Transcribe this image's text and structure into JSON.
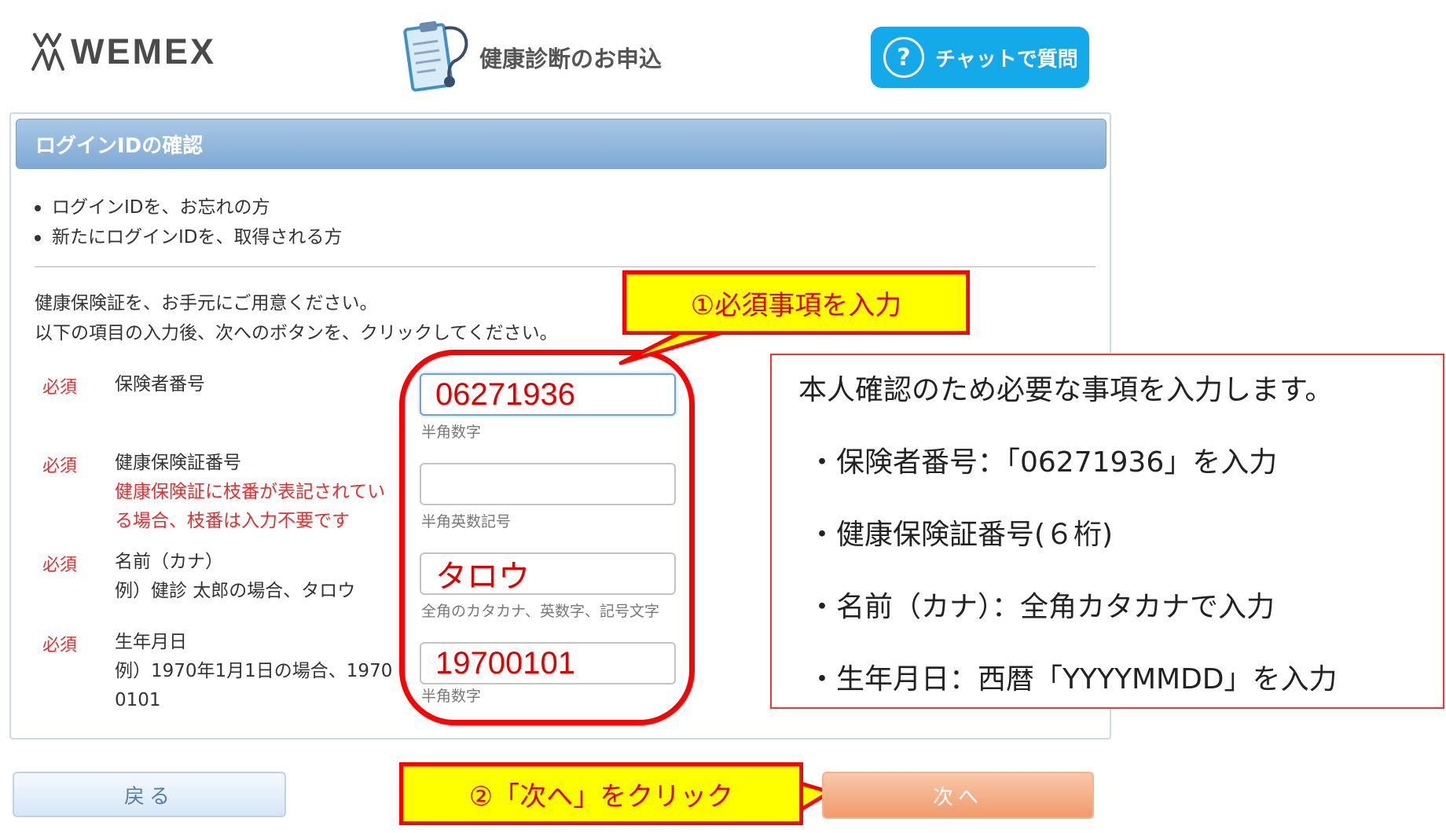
{
  "header": {
    "logo_text": "WEMEX",
    "title": "健康診断のお申込",
    "chat_icon_text": "?",
    "chat_label": "チャットで質問"
  },
  "panel": {
    "title": "ログインIDの確認",
    "bullets": [
      "ログインIDを、お忘れの方",
      "新たにログインIDを、取得される方"
    ],
    "instructions": [
      "健康保険証を、お手元にご用意ください。",
      "以下の項目の入力後、次へのボタンを、クリックしてください。"
    ]
  },
  "form": {
    "required_label": "必須",
    "fields": [
      {
        "label": "保険者番号",
        "notes": [],
        "value": "06271936",
        "hint": "半角数字"
      },
      {
        "label": "健康保険証番号",
        "notes": [
          "健康保険証に枝番が表記されてい",
          "る場合、枝番は入力不要です"
        ],
        "value": "",
        "hint": "半角英数記号"
      },
      {
        "label": "名前（カナ）",
        "notes": [
          "例）健診 太郎の場合、タロウ"
        ],
        "value": "タロウ",
        "hint": "全角のカタカナ、英数字、記号文字"
      },
      {
        "label": "生年月日",
        "notes": [
          "例）1970年1月1日の場合、1970",
          "0101"
        ],
        "value": "19700101",
        "hint": "半角数字"
      }
    ]
  },
  "annotations": {
    "callout_input": "①必須事項を入力",
    "callout_next": "②「次へ」をクリック",
    "info_title": "本人確認のため必要な事項を入力します。",
    "info_items": [
      "・保険者番号：「06271936」を入力",
      "・健康保険証番号(６桁)",
      "・名前（カナ）：全角カタカナで入力",
      "・生年月日：西暦「YYYYMMDD」を入力"
    ]
  },
  "buttons": {
    "back": "戻る",
    "next": "次へ"
  },
  "colors": {
    "accent": "#14a9e8",
    "required": "#e23030",
    "annotation_red": "#ff0000",
    "annotation_yellow": "#ffff00",
    "next_button": "#f29a6c"
  }
}
